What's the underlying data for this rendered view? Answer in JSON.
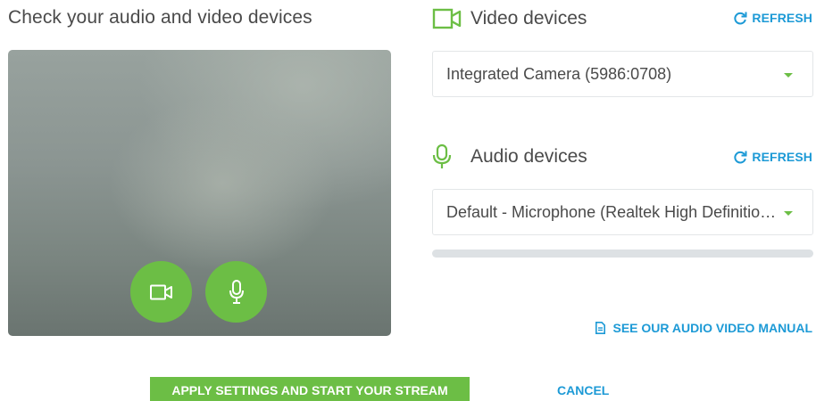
{
  "page": {
    "title": "Check your audio and video devices"
  },
  "preview": {
    "camera_icon": "camera-icon",
    "mic_icon": "microphone-icon"
  },
  "video": {
    "title": "Video devices",
    "icon": "camera-outline-icon",
    "refresh_label": "REFRESH",
    "selected_device": "Integrated Camera (5986:0708)"
  },
  "audio": {
    "title": "Audio devices",
    "icon": "microphone-outline-icon",
    "refresh_label": "REFRESH",
    "selected_device": "Default - Microphone (Realtek High Definition Audio)",
    "level": 0
  },
  "manual_link": {
    "label": "SEE OUR AUDIO VIDEO MANUAL",
    "icon": "document-icon"
  },
  "actions": {
    "apply_label": "APPLY SETTINGS AND START YOUR STREAM",
    "cancel_label": "CANCEL"
  },
  "colors": {
    "accent_green": "#6cbe45",
    "link_blue": "#1d9ad6",
    "text_dark": "#4a4a4a"
  }
}
